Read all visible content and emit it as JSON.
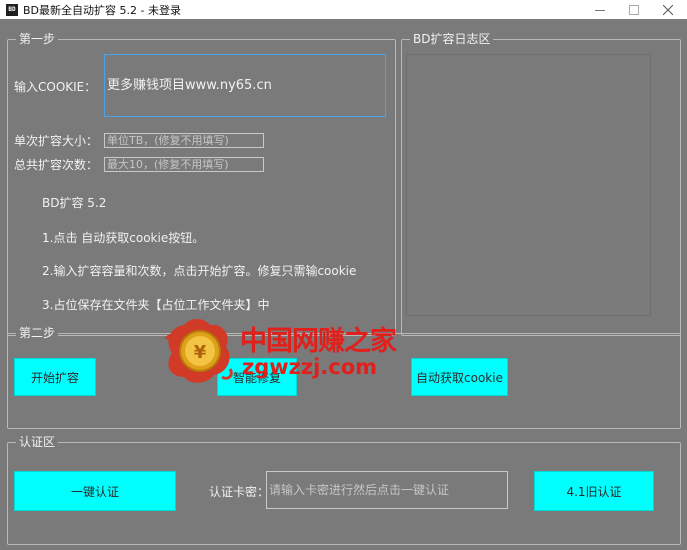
{
  "window": {
    "title": "BD最新全自动扩容 5.2 - 未登录",
    "app_icon_text": "BD"
  },
  "step1": {
    "group_title": "第一步",
    "cookie_label": "输入COOKIE：",
    "cookie_value": "更多赚钱项目www.ny65.cn",
    "single_size_label": "单次扩容大小：",
    "single_size_placeholder": "单位TB，(修复不用填写)",
    "total_count_label": "总共扩容次数：",
    "total_count_placeholder": "最大10，(修复不用填写)",
    "info_title": "BD扩容 5.2",
    "info_line1": "1.点击 自动获取cookie按钮。",
    "info_line2": "2.输入扩容容量和次数，点击开始扩容。修复只需输cookie",
    "info_line3": "3.占位保存在文件夹【占位工作文件夹】中"
  },
  "log": {
    "group_title": "BD扩容日志区"
  },
  "step2": {
    "group_title": "第二步",
    "start_button": "开始扩容",
    "repair_button": "智能修复",
    "auto_cookie_button": "自动获取cookie"
  },
  "auth": {
    "group_title": "认证区",
    "one_click_button": "一键认证",
    "card_label": "认证卡密：",
    "card_placeholder": "请输入卡密进行然后点击一键认证",
    "old_auth_button": "4.1旧认证"
  },
  "watermark": {
    "brand_text": "中国网赚之家",
    "url_text": "zgwzzj.com"
  },
  "colors": {
    "background": "#7a7a7a",
    "button": "#00ffff",
    "watermark": "#e0201c",
    "focus_border": "#4aa3e8"
  }
}
